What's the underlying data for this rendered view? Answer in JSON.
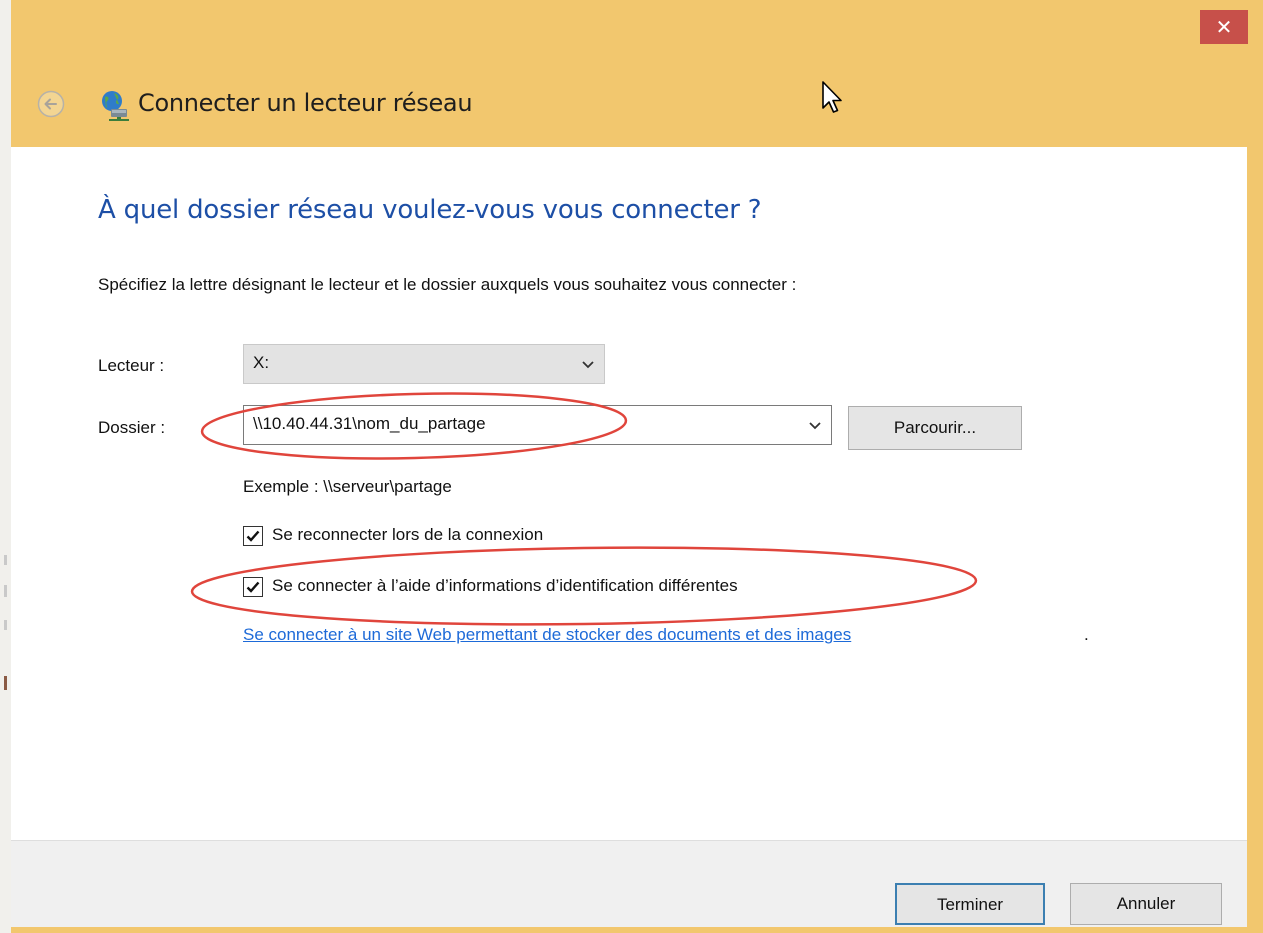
{
  "window": {
    "title": "Connecter un lecteur réseau",
    "close_label": "✕"
  },
  "page": {
    "heading": "À quel dossier réseau voulez-vous vous connecter ?",
    "instruction": "Spécifiez la lettre désignant le lecteur et le dossier auxquels vous souhaitez vous connecter :"
  },
  "form": {
    "lecteur_label": "Lecteur :",
    "lecteur_value": "X:",
    "dossier_label": "Dossier :",
    "dossier_value": "\\\\10.40.44.31\\nom_du_partage",
    "browse_label": "Parcourir...",
    "example": "Exemple : \\\\serveur\\partage",
    "reconnect": {
      "label": "Se reconnecter lors de la connexion",
      "checked": true
    },
    "different_credentials": {
      "label": "Se connecter à l’aide d’informations d’identification différentes",
      "checked": true
    },
    "website_link": "Se connecter à un site Web permettant de stocker des documents et des images",
    "website_link_suffix": "."
  },
  "footer": {
    "finish_label": "Terminer",
    "cancel_label": "Annuler"
  },
  "colors": {
    "frame": "#f2c76e",
    "close": "#c7504a",
    "heading": "#1d4fa6",
    "link": "#1d6ad8",
    "annotation": "#e0453c",
    "default_button_border": "#3c7fb1"
  },
  "icons": {
    "back": "back-arrow-icon",
    "title": "network-drive-icon",
    "close": "close-icon",
    "dropdown": "chevron-down-icon",
    "check": "checkmark-icon",
    "cursor": "mouse-pointer-icon"
  }
}
